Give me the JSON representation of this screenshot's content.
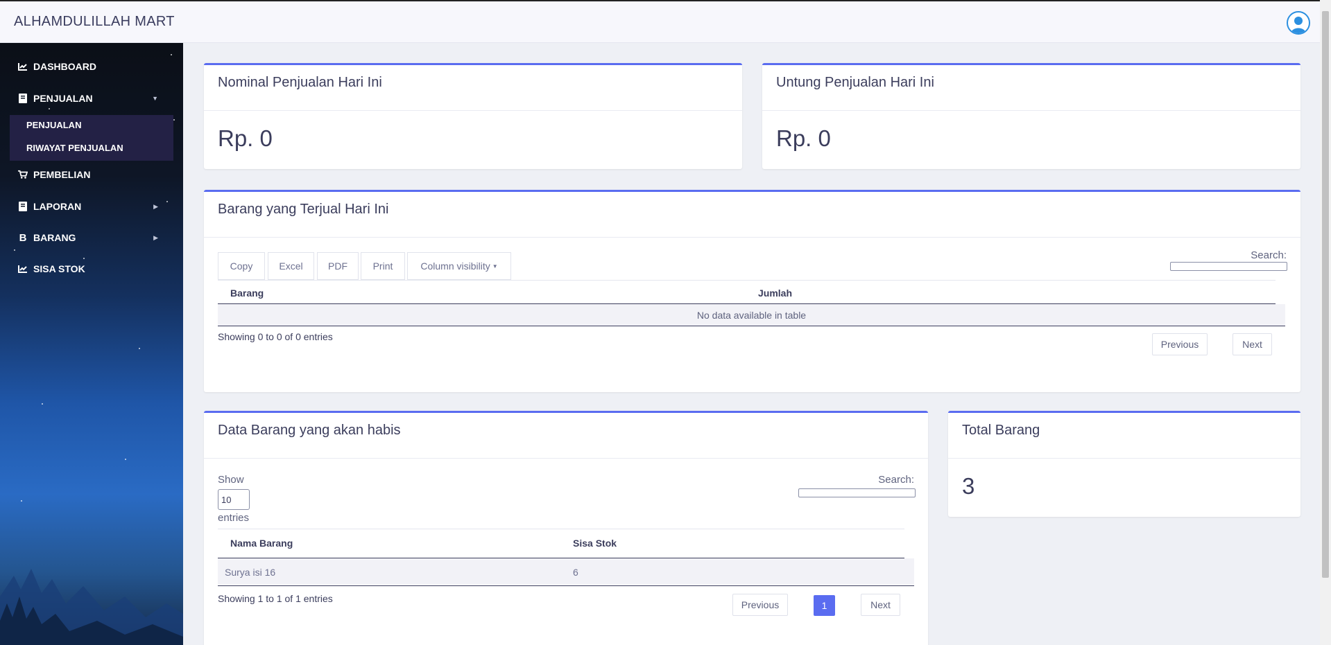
{
  "app": {
    "title": "ALHAMDULILLAH MART"
  },
  "sidebar": {
    "items": [
      {
        "label": "DASHBOARD",
        "icon": "chart-line-icon"
      },
      {
        "label": "PENJUALAN",
        "icon": "book-icon",
        "expanded": true
      },
      {
        "label": "PEMBELIAN",
        "icon": "cart-icon"
      },
      {
        "label": "LAPORAN",
        "icon": "book-icon"
      },
      {
        "label": "BARANG",
        "icon": "bitcoin-b-icon"
      },
      {
        "label": "SISA STOK",
        "icon": "chart-line-icon"
      }
    ],
    "submenu": [
      "PENJUALAN",
      "RIWAYAT PENJUALAN"
    ]
  },
  "cards": {
    "nominal": {
      "title": "Nominal Penjualan Hari Ini",
      "value": "Rp. 0"
    },
    "untung": {
      "title": "Untung Penjualan Hari Ini",
      "value": "Rp. 0"
    },
    "total": {
      "title": "Total Barang",
      "value": "3"
    }
  },
  "terjual": {
    "title": "Barang yang Terjual Hari Ini",
    "buttons": [
      "Copy",
      "Excel",
      "PDF",
      "Print",
      "Column visibility"
    ],
    "search_label": "Search:",
    "columns": [
      "Barang",
      "Jumlah"
    ],
    "empty_text": "No data available in table",
    "info": "Showing 0 to 0 of 0 entries",
    "prev": "Previous",
    "next": "Next"
  },
  "habis": {
    "title": "Data Barang yang akan habis",
    "show_label": "Show",
    "length_value": "10",
    "entries_label": "entries",
    "search_label": "Search:",
    "columns": [
      "Nama Barang",
      "Sisa Stok"
    ],
    "rows": [
      [
        "Surya isi 16",
        "6"
      ]
    ],
    "info": "Showing 1 to 1 of 1 entries",
    "prev": "Previous",
    "page": "1",
    "next": "Next"
  },
  "colors": {
    "accent": "#5a6cf0",
    "sidebar_dark": "#0b0f17",
    "submenu_bg": "#232145"
  }
}
